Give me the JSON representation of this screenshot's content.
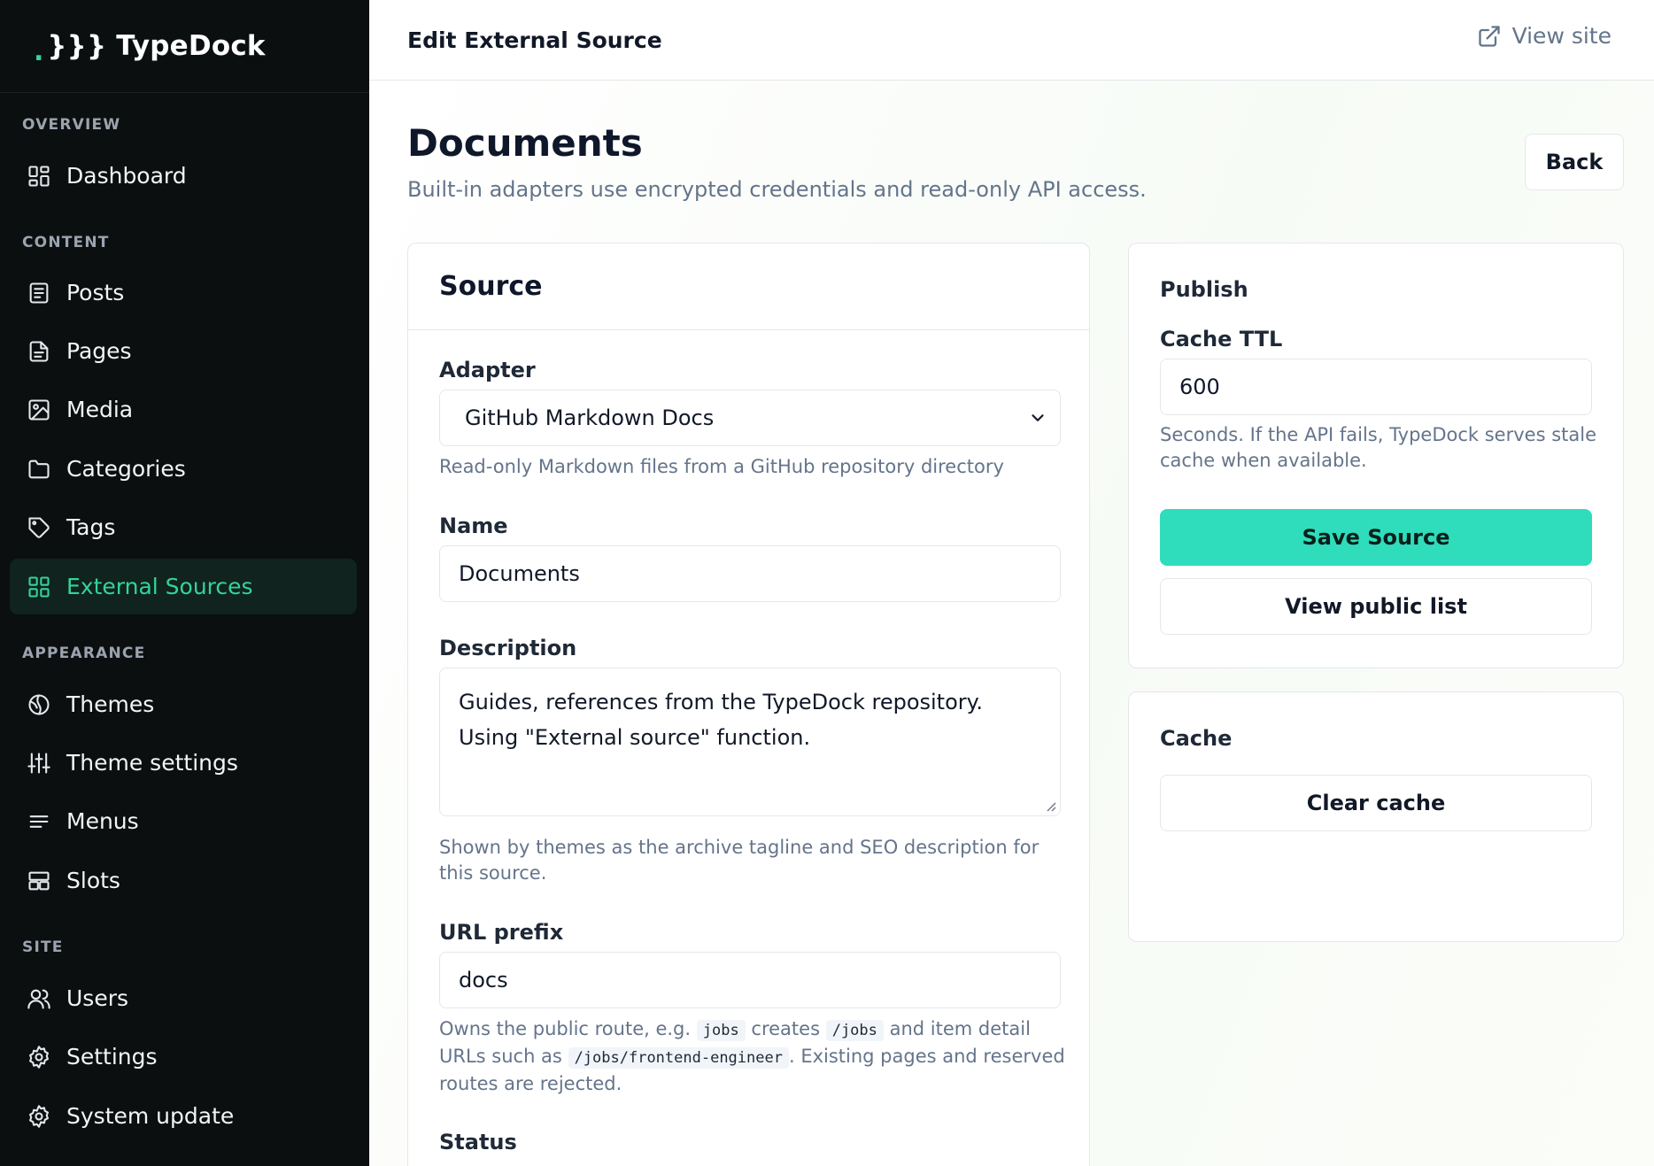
{
  "brand": {
    "mark": ".",
    "name": "}}} TypeDock"
  },
  "sidebar": {
    "sections": [
      {
        "label": "OVERVIEW"
      },
      {
        "label": "CONTENT"
      },
      {
        "label": "APPEARANCE"
      },
      {
        "label": "SITE"
      }
    ],
    "items": [
      {
        "label": "Dashboard",
        "icon": "dashboard-icon"
      },
      {
        "label": "Posts",
        "icon": "posts-icon"
      },
      {
        "label": "Pages",
        "icon": "pages-icon"
      },
      {
        "label": "Media",
        "icon": "image-icon"
      },
      {
        "label": "Categories",
        "icon": "folder-icon"
      },
      {
        "label": "Tags",
        "icon": "tag-icon"
      },
      {
        "label": "External Sources",
        "icon": "grid-icon",
        "active": true
      },
      {
        "label": "Themes",
        "icon": "globe-icon"
      },
      {
        "label": "Theme settings",
        "icon": "sliders-icon"
      },
      {
        "label": "Menus",
        "icon": "menu-icon"
      },
      {
        "label": "Slots",
        "icon": "slots-icon"
      },
      {
        "label": "Users",
        "icon": "users-icon"
      },
      {
        "label": "Settings",
        "icon": "gear-icon"
      },
      {
        "label": "System update",
        "icon": "gear-icon"
      }
    ],
    "active_color": "#34d399"
  },
  "topbar": {
    "title": "Edit External Source",
    "view_site": "View site"
  },
  "page": {
    "title": "Documents",
    "subtitle": "Built-in adapters use encrypted credentials and read-only API access.",
    "back_label": "Back"
  },
  "source_card": {
    "title": "Source",
    "adapter": {
      "label": "Adapter",
      "value": "GitHub Markdown Docs",
      "help": "Read-only Markdown files from a GitHub repository directory"
    },
    "name": {
      "label": "Name",
      "value": "Documents"
    },
    "description": {
      "label": "Description",
      "value": "Guides, references from the TypeDock repository.\nUsing \"External source\" function.",
      "help": "Shown by themes as the archive tagline and SEO description for this source."
    },
    "url_prefix": {
      "label": "URL prefix",
      "value": "docs",
      "help_1": "Owns the public route, e.g.",
      "code_1": "jobs",
      "help_2": "creates",
      "code_2": "/jobs",
      "help_3": "and item detail URLs such as",
      "code_3": "/jobs/frontend-engineer",
      "help_4": ". Existing pages and reserved routes are rejected."
    },
    "status": {
      "label": "Status"
    }
  },
  "publish_card": {
    "title": "Publish",
    "cache_ttl": {
      "label": "Cache TTL",
      "value": "600",
      "help": "Seconds. If the API fails, TypeDock serves stale cache when available."
    },
    "save_label": "Save Source",
    "view_list_label": "View public list",
    "primary_color": "#2fdcbc"
  },
  "cache_card": {
    "title": "Cache",
    "clear_label": "Clear cache"
  }
}
